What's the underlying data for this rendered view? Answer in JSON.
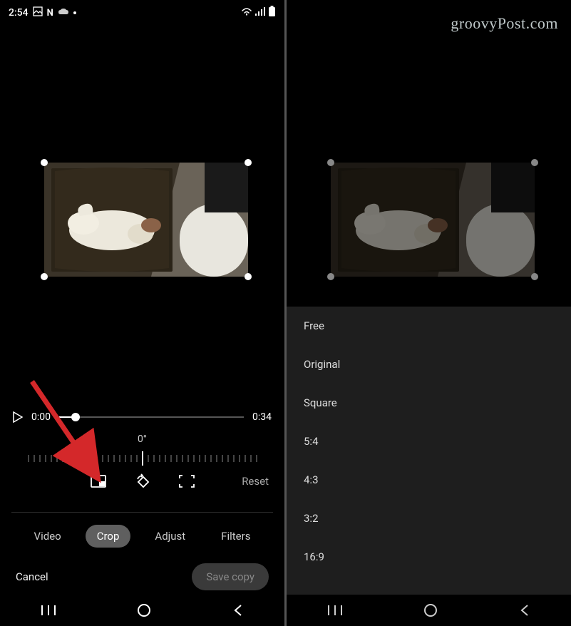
{
  "watermark": "groovyPost.com",
  "status": {
    "time": "2:54",
    "icons": [
      "image-icon",
      "netflix-icon",
      "cloud-icon",
      "dot-icon"
    ],
    "right_icons": [
      "wifi-icon",
      "signal-icon",
      "battery-icon"
    ]
  },
  "playback": {
    "current_time": "0:00",
    "duration": "0:34",
    "playing": false
  },
  "rotation": {
    "angle_label": "0°"
  },
  "crop_tools": {
    "aspect_icon": "aspect-ratio-icon",
    "rotate_icon": "rotate-icon",
    "auto_icon": "frame-corners-icon",
    "reset_label": "Reset"
  },
  "tabs": [
    {
      "label": "Video",
      "active": false
    },
    {
      "label": "Crop",
      "active": true
    },
    {
      "label": "Adjust",
      "active": false
    },
    {
      "label": "Filters",
      "active": false
    }
  ],
  "actions": {
    "cancel": "Cancel",
    "save": "Save copy"
  },
  "aspect_ratios": [
    "Free",
    "Original",
    "Square",
    "5:4",
    "4:3",
    "3:2",
    "16:9"
  ],
  "nav": [
    "recents",
    "home",
    "back"
  ]
}
